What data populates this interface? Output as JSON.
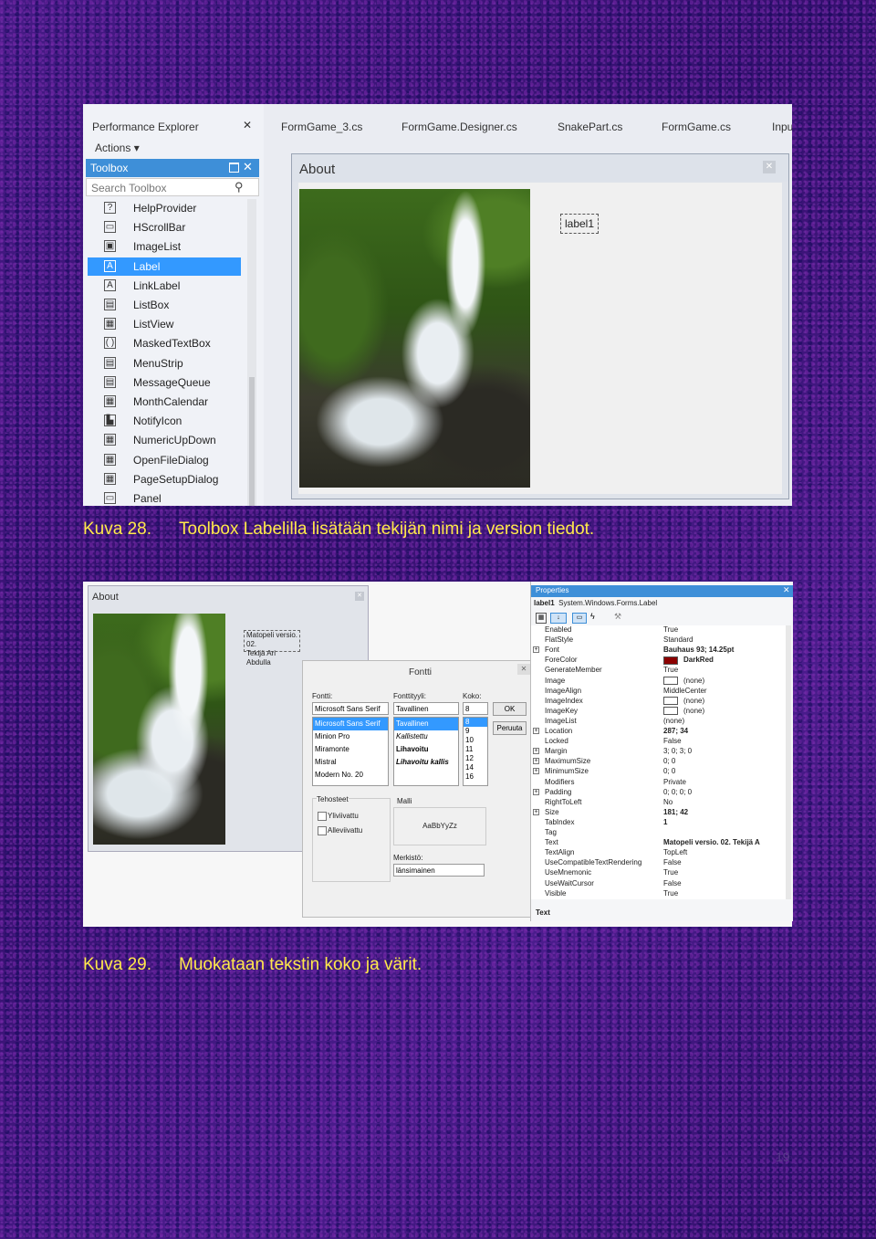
{
  "fig1": {
    "left_panel": {
      "performance_explorer": "Performance Explorer",
      "actions": "Actions",
      "toolbox_title": "Toolbox",
      "search_placeholder": "Search Toolbox",
      "items": [
        "HelpProvider",
        "HScrollBar",
        "ImageList",
        "Label",
        "LinkLabel",
        "ListBox",
        "ListView",
        "MaskedTextBox",
        "MenuStrip",
        "MessageQueue",
        "MonthCalendar",
        "NotifyIcon",
        "NumericUpDown",
        "OpenFileDialog",
        "PageSetupDialog",
        "Panel"
      ],
      "selected_item": "Label"
    },
    "tabs": [
      "FormGame_3.cs",
      "FormGame.Designer.cs",
      "SnakePart.cs",
      "FormGame.cs",
      "Inpu"
    ],
    "form_title": "About",
    "label_control": "label1",
    "caption_number": "Kuva 28.",
    "caption_text": "Toolbox Labelilla lisätään tekijän nimi ja version tiedot."
  },
  "fig2": {
    "about_title": "About",
    "label_text_line1": "Matopeli versio. 02.",
    "label_text_line2": "Tekijä Ari Abdulla",
    "font_dialog": {
      "title": "Fontti",
      "font_label": "Fontti:",
      "style_label": "Fonttityyli:",
      "size_label": "Koko:",
      "font_value": "Microsoft Sans Serif",
      "style_value": "Tavallinen",
      "size_value": "8",
      "fonts": [
        "Microsoft Sans Serif",
        "Minion Pro",
        "Miramonte",
        "Mistral",
        "Modern No. 20"
      ],
      "styles": [
        "Tavallinen",
        "Kallistettu",
        "Lihavoitu",
        "Lihavoitu kallis"
      ],
      "sizes": [
        "8",
        "9",
        "10",
        "11",
        "12",
        "14",
        "16"
      ],
      "ok": "OK",
      "cancel": "Peruuta",
      "effects_label": "Tehosteet",
      "strikeout": "Yliviivattu",
      "underline": "Alleviivattu",
      "sample_label": "Malli",
      "sample_text": "AaBbYyZz",
      "script_label": "Merkistö:",
      "script_value": "länsimainen"
    },
    "properties": {
      "title": "Properties",
      "object": "label1",
      "object_type": "System.Windows.Forms.Label",
      "rows": [
        {
          "name": "Enabled",
          "value": "True"
        },
        {
          "name": "FlatStyle",
          "value": "Standard"
        },
        {
          "name": "Font",
          "value": "Bauhaus 93; 14.25pt",
          "expand": true,
          "bold": true
        },
        {
          "name": "ForeColor",
          "value": "DarkRed",
          "swatch": "#8b0000",
          "bold": true
        },
        {
          "name": "GenerateMember",
          "value": "True"
        },
        {
          "name": "Image",
          "value": "(none)",
          "swatch": "#ffffff"
        },
        {
          "name": "ImageAlign",
          "value": "MiddleCenter"
        },
        {
          "name": "ImageIndex",
          "value": "(none)",
          "swatch": "#ffffff"
        },
        {
          "name": "ImageKey",
          "value": "(none)",
          "swatch": "#ffffff"
        },
        {
          "name": "ImageList",
          "value": "(none)"
        },
        {
          "name": "Location",
          "value": "287; 34",
          "expand": true,
          "bold": true
        },
        {
          "name": "Locked",
          "value": "False"
        },
        {
          "name": "Margin",
          "value": "3; 0; 3; 0",
          "expand": true
        },
        {
          "name": "MaximumSize",
          "value": "0; 0",
          "expand": true
        },
        {
          "name": "MinimumSize",
          "value": "0; 0",
          "expand": true
        },
        {
          "name": "Modifiers",
          "value": "Private"
        },
        {
          "name": "Padding",
          "value": "0; 0; 0; 0",
          "expand": true
        },
        {
          "name": "RightToLeft",
          "value": "No"
        },
        {
          "name": "Size",
          "value": "181; 42",
          "expand": true,
          "bold": true
        },
        {
          "name": "TabIndex",
          "value": "1",
          "bold": true
        },
        {
          "name": "Tag",
          "value": ""
        },
        {
          "name": "Text",
          "value": "Matopeli versio. 02. Tekijä A",
          "bold": true
        },
        {
          "name": "TextAlign",
          "value": "TopLeft"
        },
        {
          "name": "UseCompatibleTextRendering",
          "value": "False"
        },
        {
          "name": "UseMnemonic",
          "value": "True"
        },
        {
          "name": "UseWaitCursor",
          "value": "False"
        },
        {
          "name": "Visible",
          "value": "True"
        }
      ],
      "footer": "Text"
    },
    "caption_number": "Kuva 29.",
    "caption_text": "Muokataan tekstin koko ja värit."
  },
  "page_number": "19"
}
